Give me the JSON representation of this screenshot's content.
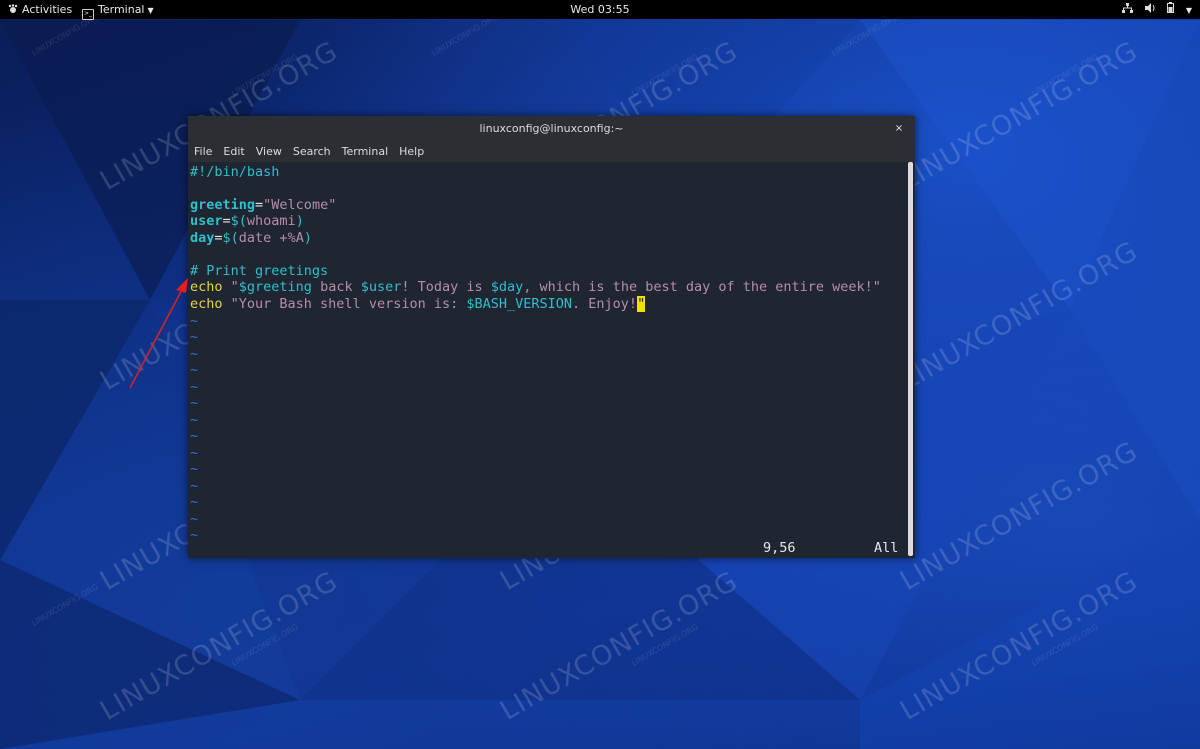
{
  "topbar": {
    "activities": "Activities",
    "app_name": "Terminal",
    "clock": "Wed 03:55"
  },
  "watermark": "LINUXCONFIG.ORG",
  "window": {
    "title": "linuxconfig@linuxconfig:~",
    "close_glyph": "×",
    "menu": [
      "File",
      "Edit",
      "View",
      "Search",
      "Terminal",
      "Help"
    ]
  },
  "editor": {
    "shebang": "#!/bin/bash",
    "l3_var": "greeting",
    "l3_eq": "=",
    "l3_val": "\"Welcome\"",
    "l4_var": "user",
    "l4_eq": "=",
    "l4_dollar": "$(",
    "l4_cmd": "whoami",
    "l4_close": ")",
    "l5_var": "day",
    "l5_eq": "=",
    "l5_dollar": "$(",
    "l5_cmd": "date +%A",
    "l5_close": ")",
    "comment": "# Print greetings",
    "l8_echo": "echo",
    "l8_q1": " \"",
    "l8_v1": "$greeting",
    "l8_t1": " back ",
    "l8_v2": "$user",
    "l8_t2": "! Today is ",
    "l8_v3": "$day",
    "l8_t3": ", which is the best day of the entire week!\"",
    "l9_echo": "echo",
    "l9_t1": " \"Your Bash shell version is: ",
    "l9_v1": "$BASH_VERSION",
    "l9_t2": ". Enjoy!",
    "l9_cursor": "\"",
    "tilde": "~",
    "status_pos": "9,56",
    "status_all": "All"
  },
  "colors": {
    "accent_teal": "#2fc0c9",
    "string_violet": "#b48ead",
    "keyword_yellow": "#e3d54a",
    "cursor_yellow": "#f2e100",
    "arrow_red": "#e02020"
  }
}
